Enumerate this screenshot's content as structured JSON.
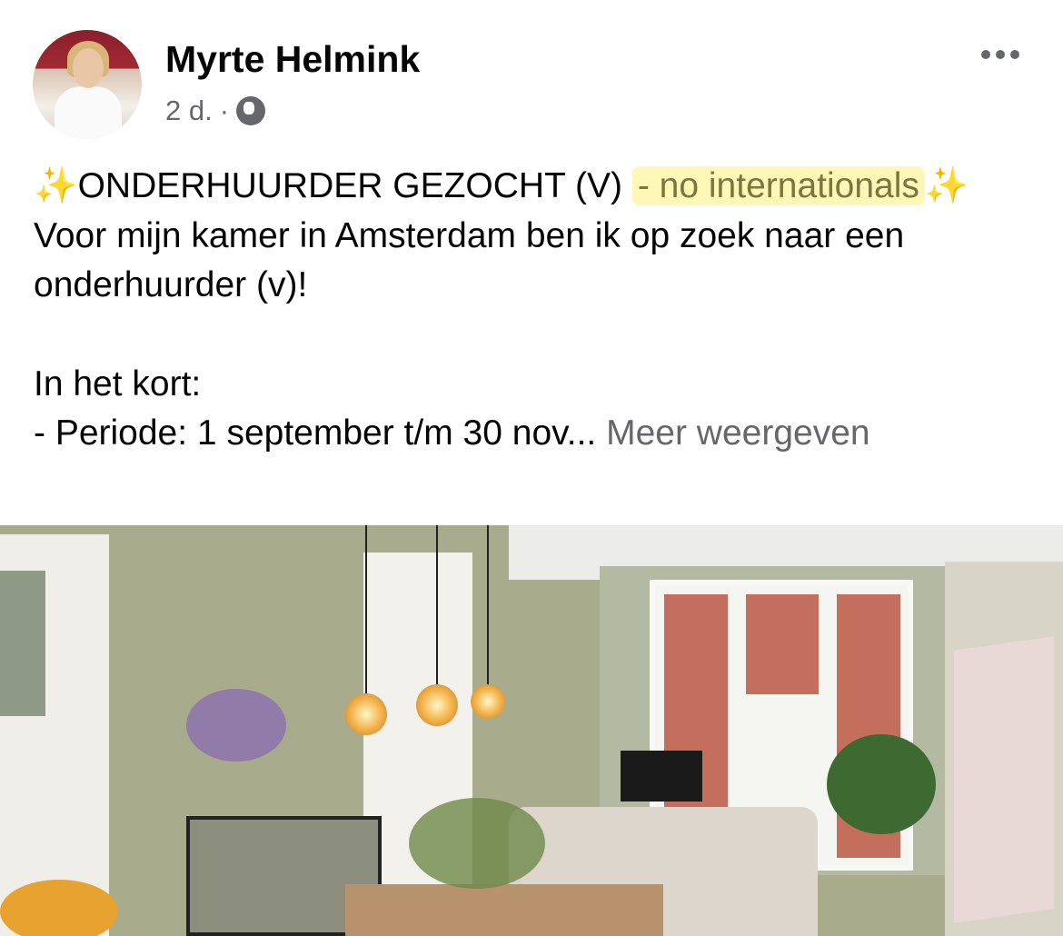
{
  "post": {
    "author": "Myrte Helmink",
    "time": "2 d.",
    "separator": "·",
    "privacy_icon": "globe-icon",
    "more_icon": "more-dots-icon",
    "text": {
      "title_prefix": "✨",
      "title": "ONDERHUURDER GEZOCHT (V) ",
      "highlight": "- no internationals",
      "title_suffix": "✨",
      "line1": "Voor mijn kamer in Amsterdam ben ik op zoek naar een onderhuurder (v)!",
      "line2": "In het kort:",
      "line3": "- Periode: 1 september t/m 30 nov...",
      "see_more": "Meer weergeven"
    },
    "highlight_color": "#fff078"
  }
}
